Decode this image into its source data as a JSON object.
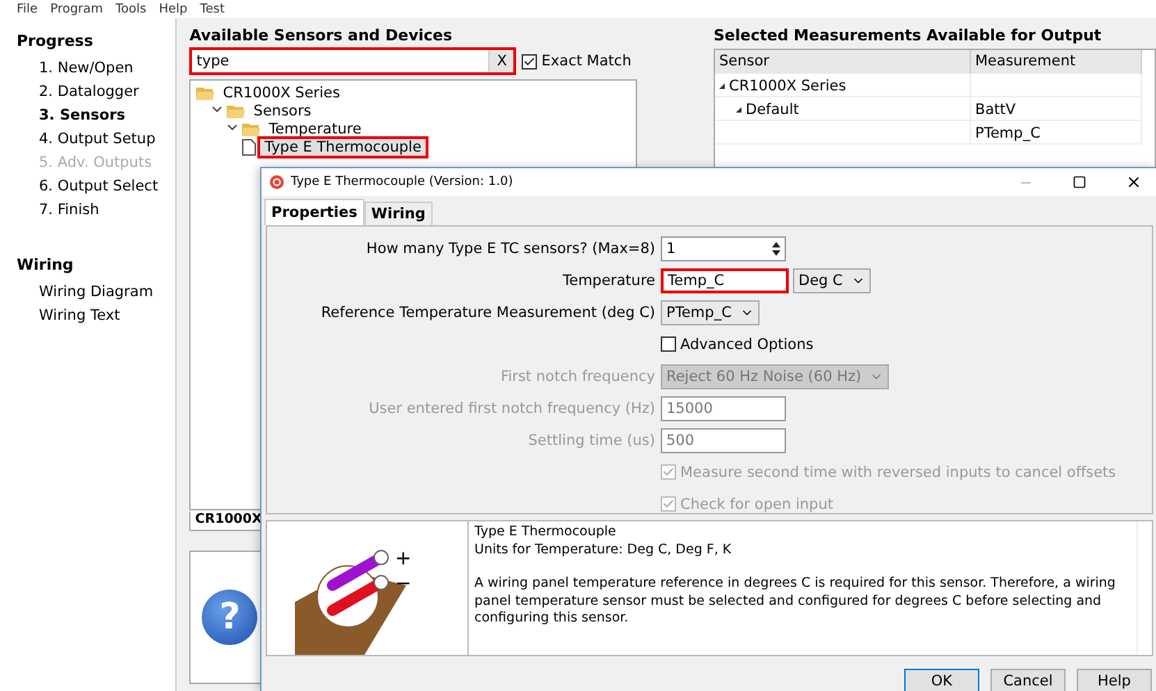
{
  "menu": [
    "File",
    "Program",
    "Tools",
    "Help",
    "Test"
  ],
  "progress": {
    "title": "Progress",
    "items": [
      {
        "label": "1. New/Open",
        "selected": false,
        "disabled": false
      },
      {
        "label": "2. Datalogger",
        "selected": false,
        "disabled": false
      },
      {
        "label": "3. Sensors",
        "selected": true,
        "disabled": false
      },
      {
        "label": "4. Output Setup",
        "selected": false,
        "disabled": false
      },
      {
        "label": "5. Adv. Outputs",
        "selected": false,
        "disabled": true
      },
      {
        "label": "6. Output Select",
        "selected": false,
        "disabled": false
      },
      {
        "label": "7. Finish",
        "selected": false,
        "disabled": false
      }
    ]
  },
  "wiring": {
    "title": "Wiring",
    "items": [
      {
        "label": "Wiring Diagram"
      },
      {
        "label": "Wiring Text"
      }
    ]
  },
  "available": {
    "title": "Available Sensors and Devices",
    "search": {
      "value": "type",
      "clear": "X",
      "highlighted": true
    },
    "exact_match": {
      "label": "Exact Match",
      "checked": true
    },
    "tree": [
      {
        "label": "CR1000X Series",
        "kind": "folder",
        "children": [
          {
            "label": "Sensors",
            "kind": "folder",
            "expanded": true,
            "children": [
              {
                "label": "Temperature",
                "kind": "folder",
                "expanded": true,
                "children": [
                  {
                    "label": "Type E Thermocouple",
                    "kind": "file",
                    "selected": true,
                    "highlighted": true
                  }
                ]
              }
            ]
          }
        ]
      }
    ],
    "tab": "CR1000X",
    "help_glyph": "?"
  },
  "selected_measurements": {
    "title": "Selected Measurements Available for Output",
    "columns": [
      "Sensor",
      "Measurement"
    ],
    "rows": [
      {
        "sensor": "CR1000X Series",
        "expanded": true,
        "children": [
          {
            "sensor": "Default",
            "measurement": "BattV",
            "expanded": true,
            "children": [
              {
                "measurement": "PTemp_C"
              }
            ]
          }
        ]
      }
    ]
  },
  "dialog": {
    "title": "Type E Thermocouple (Version: 1.0)",
    "tabs": [
      {
        "label": "Properties",
        "selected": true
      },
      {
        "label": "Wiring",
        "selected": false
      }
    ],
    "fields": [
      {
        "kind": "spinner",
        "label": "How many Type E TC sensors? (Max=8)",
        "value": "1"
      },
      {
        "kind": "text_unit",
        "label": "Temperature",
        "value": "Temp_C",
        "unit": "Deg C",
        "highlighted": true,
        "disabled": false
      },
      {
        "kind": "select",
        "label": "Reference Temperature Measurement (deg C)",
        "value": "PTemp_C",
        "disabled": false
      },
      {
        "kind": "checkbox",
        "label": "Advanced Options",
        "checked": false,
        "disabled": false
      },
      {
        "kind": "select",
        "label": "First notch frequency",
        "value": "Reject 60 Hz Noise (60 Hz)",
        "disabled": true
      },
      {
        "kind": "text",
        "label": "User entered first notch frequency (Hz)",
        "value": "15000",
        "disabled": true
      },
      {
        "kind": "text",
        "label": "Settling time (us)",
        "value": "500",
        "disabled": true
      },
      {
        "kind": "checkbox",
        "label": "Measure second time with reversed inputs to cancel offsets",
        "checked": true,
        "disabled": true
      },
      {
        "kind": "checkbox",
        "label": "Check for open input",
        "checked": true,
        "disabled": true
      }
    ],
    "info": {
      "heading": "Type E Thermocouple",
      "units": "Units for Temperature: Deg C, Deg F, K",
      "text": "A wiring panel temperature reference in degrees C is required for this sensor. Therefore, a wiring panel temperature sensor must be selected and configured for degrees C before selecting and configuring this sensor.",
      "plus": "+",
      "minus": "−"
    },
    "buttons": [
      "OK",
      "Cancel",
      "Help"
    ]
  }
}
